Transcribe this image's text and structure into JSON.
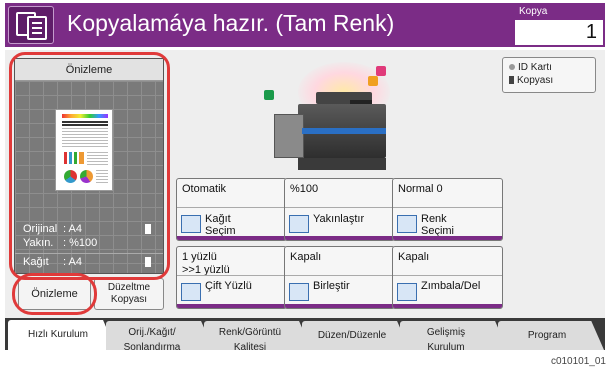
{
  "header": {
    "title": "Kopyalamáya hazır. (Tam Renk)",
    "copy_label": "Kopya",
    "copy_count": "1"
  },
  "preview": {
    "title": "Önizleme",
    "original_key": "Orijinal",
    "original_value": ": A4",
    "zoom_key": "Yakın.",
    "zoom_value": ": %100",
    "paper_key": "Kağıt",
    "paper_value": ": A4",
    "preview_button": "Önizleme",
    "fix_copy_button_line1": "Düzeltme",
    "fix_copy_button_line2": "Kopyası"
  },
  "id_card": {
    "line1": "ID Kartı",
    "line2": "Kopyası"
  },
  "functions": [
    {
      "value_line1": "Otomatik",
      "value_line2": "",
      "label_line1": "Kağıt",
      "label_line2": "Seçim"
    },
    {
      "value_line1": "%100",
      "value_line2": "",
      "label_line1": "Yakınlaştır",
      "label_line2": ""
    },
    {
      "value_line1": "Normal 0",
      "value_line2": "",
      "label_line1": "Renk",
      "label_line2": "Seçimi"
    },
    {
      "value_line1": "1 yüzlü",
      "value_line2": ">>1 yüzlü",
      "label_line1": "Çift Yüzlü",
      "label_line2": ""
    },
    {
      "value_line1": "Kapalı",
      "value_line2": "",
      "label_line1": "Birleştir",
      "label_line2": ""
    },
    {
      "value_line1": "Kapalı",
      "value_line2": "",
      "label_line1": "Zımbala/Del",
      "label_line2": ""
    }
  ],
  "tabs": [
    {
      "line1": "Hızlı Kurulum",
      "line2": ""
    },
    {
      "line1": "Orij./Kağıt/",
      "line2": "Sonlandırma"
    },
    {
      "line1": "Renk/Görüntü",
      "line2": "Kalitesi"
    },
    {
      "line1": "Düzen/Düzenle",
      "line2": ""
    },
    {
      "line1": "Gelişmiş",
      "line2": "Kurulum"
    },
    {
      "line1": "Program",
      "line2": ""
    }
  ],
  "figure_ref": "c010101_01",
  "colors": {
    "accent": "#7b2c86",
    "highlight": "#e03a3a"
  }
}
